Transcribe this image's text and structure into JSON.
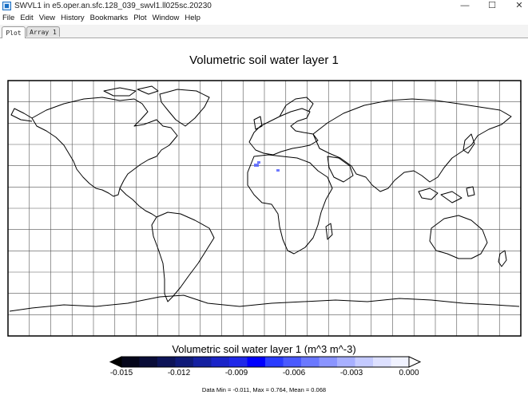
{
  "window": {
    "title": "SWVL1 in e5.oper.an.sfc.128_039_swvl1.ll025sc.20230",
    "controls": [
      "—",
      "☐",
      "✕"
    ],
    "icon": "panoply-app-icon"
  },
  "menu": [
    "File",
    "Edit",
    "View",
    "History",
    "Bookmarks",
    "Plot",
    "Window",
    "Help"
  ],
  "tabs": [
    {
      "label": "Plot",
      "active": true
    },
    {
      "label": "Array 1",
      "active": false
    }
  ],
  "plot": {
    "title": "Volumetric soil water layer 1",
    "colorbar_title": "Volumetric soil water layer 1 (m^3 m^-3)",
    "colorbar_ticks": [
      "-0.015",
      "-0.012",
      "-0.009",
      "-0.006",
      "-0.003",
      "0.000"
    ],
    "colorbar_colors": [
      "#05061a",
      "#0a0d38",
      "#0d1458",
      "#0f1a78",
      "#1420a0",
      "#1a24c8",
      "#1f28e8",
      "#0000ff",
      "#2a3cff",
      "#4a5aff",
      "#6a78ff",
      "#8a94ff",
      "#a8b0ff",
      "#c4caff",
      "#dde0ff",
      "#f0f2ff"
    ],
    "stats": "Data Min = -0.011, Max = 0.764, Mean = 0.068"
  }
}
